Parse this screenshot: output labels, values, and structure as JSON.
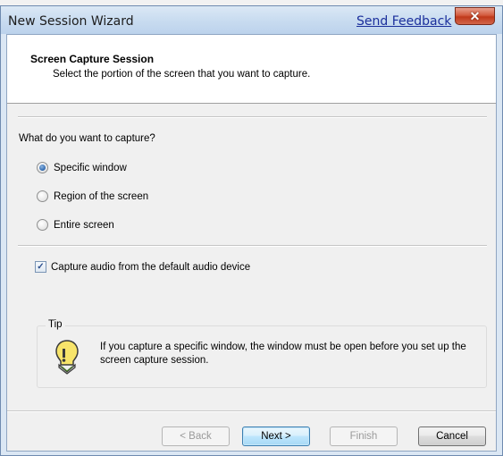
{
  "window": {
    "title": "New Session Wizard",
    "feedback_link": "Send Feedback",
    "close_glyph": "✕"
  },
  "header": {
    "title": "Screen Capture Session",
    "subtitle": "Select the portion of the screen that you want to capture."
  },
  "capture": {
    "question": "What do you want to capture?",
    "options": [
      {
        "label": "Specific window",
        "checked": true
      },
      {
        "label": "Region of the screen",
        "checked": false
      },
      {
        "label": "Entire screen",
        "checked": false
      }
    ]
  },
  "audio": {
    "label": "Capture audio from the default audio device",
    "checked": true
  },
  "tip": {
    "legend": "Tip",
    "icon": "lightbulb-icon",
    "text": "If you capture a specific window, the window must be open before you set up the screen capture session."
  },
  "buttons": {
    "back": "< Back",
    "next": "Next >",
    "finish": "Finish",
    "cancel": "Cancel"
  },
  "colors": {
    "titlebar": "#c9dcf0",
    "close_button": "#c0391b",
    "link": "#1b2f9c",
    "default_button": "#3c7fb1"
  }
}
